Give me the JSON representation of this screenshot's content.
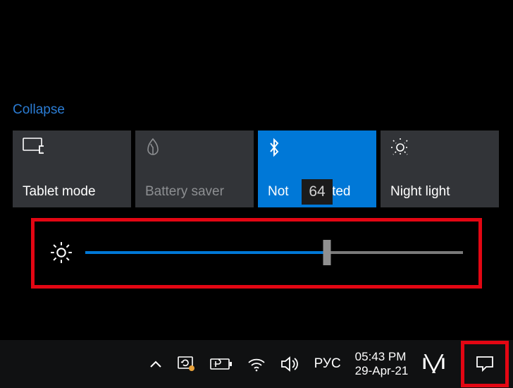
{
  "collapse_label": "Collapse",
  "tiles": {
    "tablet": {
      "label": "Tablet mode"
    },
    "battery": {
      "label": "Battery saver"
    },
    "bluetooth": {
      "label_prefix": "Not",
      "label_suffix": "cted"
    },
    "night": {
      "label": "Night light"
    }
  },
  "brightness": {
    "value": 64,
    "tooltip": "64"
  },
  "taskbar": {
    "language": "РУС",
    "time": "05:43 PM",
    "date": "29-Apr-21"
  }
}
